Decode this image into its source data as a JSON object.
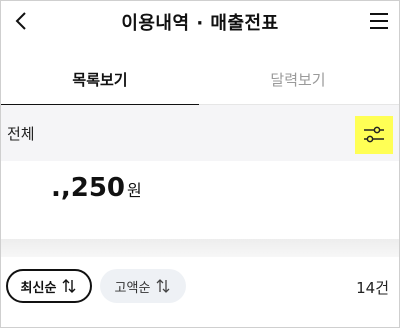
{
  "header": {
    "title": "이용내역 · 매출전표",
    "back_icon": "chevron-left-icon",
    "menu_icon": "hamburger-menu-icon"
  },
  "tabs": [
    {
      "label": "목록보기",
      "active": true
    },
    {
      "label": "달력보기",
      "active": false
    }
  ],
  "filter": {
    "label": "전체",
    "icon": "sliders-icon",
    "highlight_color": "#ffff55"
  },
  "summary": {
    "amount": ".,250",
    "unit": "원"
  },
  "sort": {
    "latest_label": "최신순",
    "amount_label": "고액순",
    "arrow_icon": "sort-updown-icon",
    "count": "14건"
  }
}
